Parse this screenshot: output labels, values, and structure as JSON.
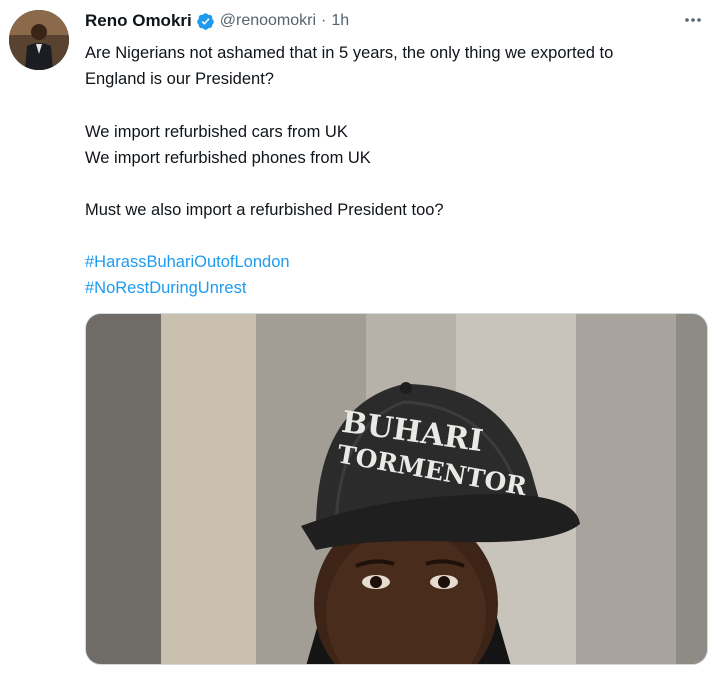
{
  "author": {
    "name": "Reno Omokri",
    "handle": "@renoomokri",
    "separator": "·",
    "time": "1h",
    "verified": true
  },
  "icons": {
    "avatar": "avatar-photo",
    "verified": "verified-badge-icon",
    "more": "more-options-icon"
  },
  "tweet": {
    "lines": [
      "Are Nigerians not ashamed that in 5 years, the only thing we exported to",
      "England is our President?",
      "We import refurbished cars from UK",
      "We import refurbished phones from UK",
      "Must we also import a refurbished President too?"
    ],
    "hashtags": [
      "#HarassBuhariOutofLondon",
      "#NoRestDuringUnrest"
    ]
  },
  "media": {
    "cap_text": [
      "BUHARI",
      "TORMENTOR"
    ]
  },
  "colors": {
    "link": "#1d9bf0",
    "verified": "#1d9bf0",
    "secondary_text": "#536471"
  }
}
